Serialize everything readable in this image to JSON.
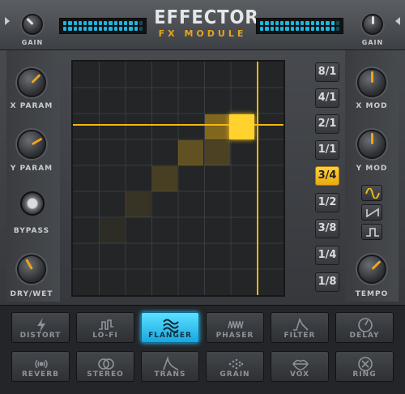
{
  "header": {
    "title": "EFFECTOR",
    "subtitle": "FX MODULE",
    "left_knob_label": "GAIN",
    "right_knob_label": "GAIN"
  },
  "left_panel": {
    "x_param_label": "X PARAM",
    "y_param_label": "Y PARAM",
    "bypass_label": "BYPASS",
    "drywet_label": "DRY/WET"
  },
  "right_panel": {
    "x_mod_label": "X MOD",
    "y_mod_label": "Y MOD",
    "tempo_label": "TEMPO"
  },
  "rates": {
    "items": [
      "8/1",
      "4/1",
      "2/1",
      "1/1",
      "3/4",
      "1/2",
      "3/8",
      "1/4",
      "1/8"
    ],
    "selected": "3/4"
  },
  "waveforms": [
    "sine-wave-icon",
    "saw-wave-icon",
    "square-wave-icon"
  ],
  "effects": {
    "row1": [
      "DISTORT",
      "LO-FI",
      "FLANGER",
      "PHASER",
      "FILTER",
      "DELAY"
    ],
    "row2": [
      "REVERB",
      "STEREO",
      "TRANS",
      "GRAIN",
      "VOX",
      "RING"
    ],
    "active": "FLANGER"
  },
  "colors": {
    "accent": "#f3b614",
    "meter": "#1eb5e0",
    "active_fx": "#39c4f5"
  }
}
